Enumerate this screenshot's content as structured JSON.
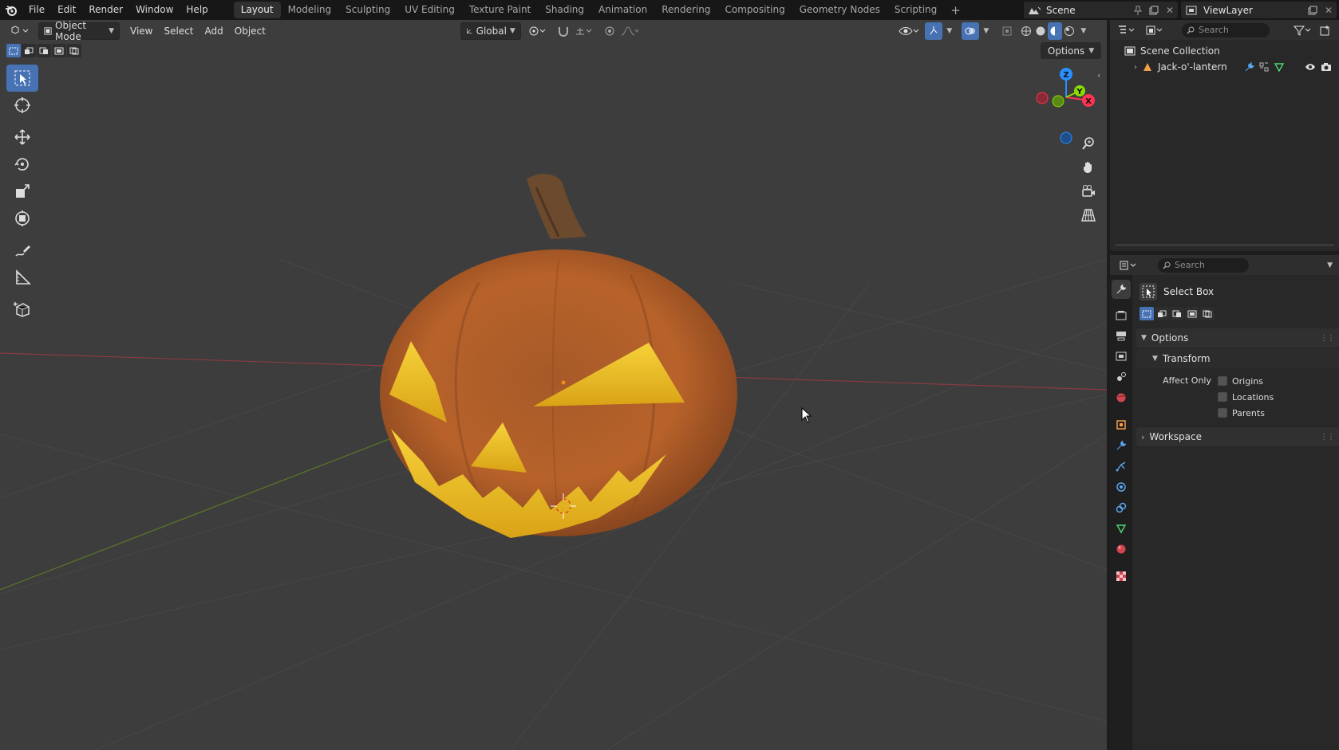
{
  "menus": [
    "File",
    "Edit",
    "Render",
    "Window",
    "Help"
  ],
  "workspace_tabs": [
    "Layout",
    "Modeling",
    "Sculpting",
    "UV Editing",
    "Texture Paint",
    "Shading",
    "Animation",
    "Rendering",
    "Compositing",
    "Geometry Nodes",
    "Scripting"
  ],
  "active_workspace": "Layout",
  "scene": {
    "name": "Scene"
  },
  "view_layer": {
    "name": "ViewLayer"
  },
  "viewport": {
    "mode": "Object Mode",
    "menus": [
      "View",
      "Select",
      "Add",
      "Object"
    ],
    "orientation": "Global",
    "options_label": "Options",
    "gizmo_axes": {
      "x": "X",
      "y": "Y",
      "z": "Z"
    }
  },
  "toolbar": {
    "tools": [
      "select-box",
      "cursor",
      "move",
      "rotate",
      "scale",
      "transform",
      "annotate",
      "measure",
      "add-cube"
    ],
    "active": "select-box"
  },
  "outliner": {
    "search_placeholder": "Search",
    "collection": "Scene Collection",
    "objects": [
      {
        "name": "Jack-o'-lantern"
      }
    ]
  },
  "properties": {
    "search_placeholder": "Search",
    "active_tool": "Select Box",
    "panels": {
      "options": "Options",
      "transform": "Transform",
      "affect_only_label": "Affect Only",
      "affect_only": [
        {
          "label": "Origins",
          "checked": false
        },
        {
          "label": "Locations",
          "checked": false
        },
        {
          "label": "Parents",
          "checked": false
        }
      ],
      "workspace": "Workspace"
    }
  },
  "colors": {
    "accent": "#4772b3",
    "x_axis": "#ff3352",
    "y_axis": "#8bdc00",
    "z_axis": "#2890ff",
    "pumpkin": "#b8622a",
    "glow": "#f3c51c"
  }
}
